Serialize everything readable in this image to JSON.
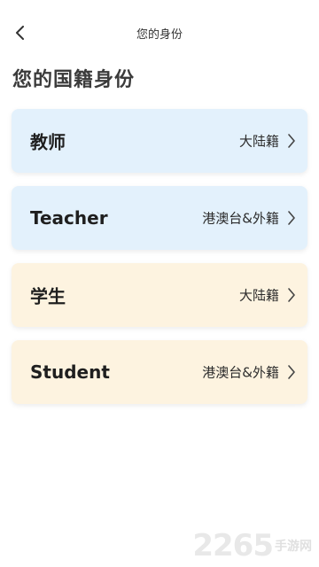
{
  "header": {
    "title": "您的身份",
    "back_icon": "chevron-left-icon"
  },
  "page_title": "您的国籍身份",
  "options": [
    {
      "role": "教师",
      "region": "大陆籍",
      "theme": "teacher",
      "color": "#e3f1fc"
    },
    {
      "role": "Teacher",
      "region": "港澳台&外籍",
      "theme": "teacher",
      "color": "#e3f1fc"
    },
    {
      "role": "学生",
      "region": "大陆籍",
      "theme": "student",
      "color": "#fdf3e0"
    },
    {
      "role": "Student",
      "region": "港澳台&外籍",
      "theme": "student",
      "color": "#fdf3e0"
    }
  ],
  "watermark": {
    "logo": "2265",
    "sub": "手游网"
  }
}
